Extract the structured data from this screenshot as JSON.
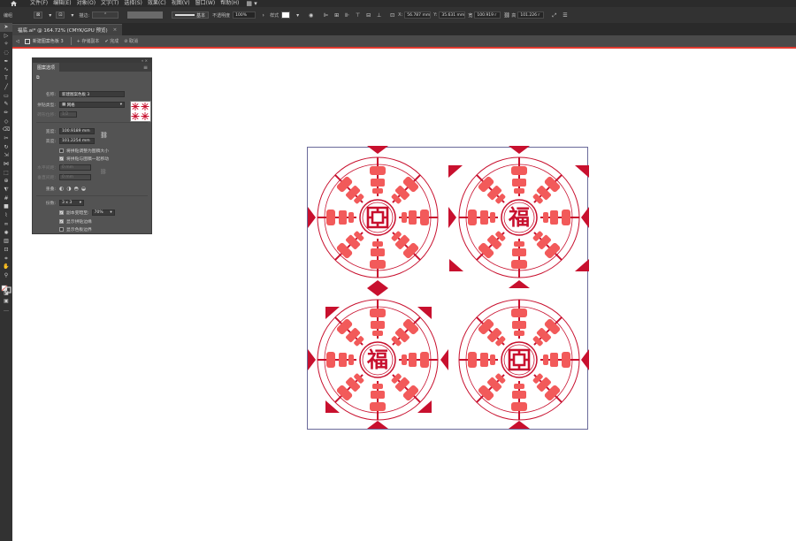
{
  "menubar": {
    "items": [
      "文件(F)",
      "编辑(E)",
      "对象(O)",
      "文字(T)",
      "选择(S)",
      "效果(C)",
      "视图(V)",
      "窗口(W)",
      "帮助(H)"
    ]
  },
  "controlbar": {
    "label_left": "编组",
    "stroke_label": "基本",
    "opacity_label": "不透明度",
    "opacity_value": "100%",
    "style_label": "样式",
    "x_value": "56.787 mm",
    "y_value": "35.631 mm",
    "w_label": "宽",
    "w_value": "100.919 r",
    "h_label": "高",
    "h_value": "101.226 r"
  },
  "document": {
    "tab_title": "福底.ai* @ 164.72% (CMYK/GPU 预览)",
    "close_glyph": "×"
  },
  "pattern_bar": {
    "crumb": "新建图案色板 3",
    "save_copy": "存储副本",
    "done": "完成",
    "cancel": "取消"
  },
  "panel": {
    "title": "图案选项",
    "name_label": "名称:",
    "name_value": "新建图案色板 3",
    "tile_type_label": "拼贴类型:",
    "tile_type_value": "网格",
    "brick_offset_label": "砖形位移:",
    "brick_offset_value": "1/2",
    "width_label": "宽度:",
    "width_value": "100.9189 mm",
    "height_label": "高度:",
    "height_value": "101.2254 mm",
    "resize_tile": "将拼贴调整为图稿大小",
    "move_tile": "将拼贴与图稿一起移动",
    "h_spacing_label": "水平间距:",
    "h_spacing_value": "0 mm",
    "v_spacing_label": "垂直间距:",
    "v_spacing_value": "0 mm",
    "overlap_label": "重叠:",
    "copies_label": "份数:",
    "copies_value": "3 x 3",
    "dim_copies": "副本变暗至:",
    "dim_copies_value": "70%",
    "show_tile_edge": "显示拼贴边缘",
    "show_swatch_bounds": "显示色板边界",
    "checks": {
      "resize_tile": false,
      "move_tile": true,
      "dim_copies": true,
      "show_tile_edge": true,
      "show_swatch_bounds": false
    }
  },
  "canvas": {
    "motif_glyph": "福",
    "colors": {
      "light": "#f25a5a",
      "dark": "#c8102e",
      "tile_border": "#6a6a9a"
    },
    "medallions": [
      {
        "kind": "seal-spiral"
      },
      {
        "kind": "fu"
      },
      {
        "kind": "fu"
      },
      {
        "kind": "seal-spiral"
      }
    ]
  },
  "icons": {
    "home": "home-icon",
    "link": "link-icon",
    "tools": [
      "selection-tool-icon",
      "direct-selection-tool-icon",
      "magic-wand-icon",
      "lasso-icon",
      "pen-tool-icon",
      "curvature-icon",
      "type-tool-icon",
      "line-tool-icon",
      "rectangle-tool-icon",
      "paintbrush-icon",
      "pencil-icon",
      "shaper-icon",
      "eraser-icon",
      "scissors-icon",
      "rotate-icon",
      "scale-icon",
      "width-icon",
      "free-transform-icon",
      "shape-builder-icon",
      "perspective-icon",
      "mesh-icon",
      "gradient-icon",
      "eyedropper-icon",
      "blend-icon",
      "symbol-sprayer-icon",
      "column-graph-icon",
      "artboard-icon",
      "slice-icon",
      "hand-icon",
      "zoom-icon"
    ]
  }
}
